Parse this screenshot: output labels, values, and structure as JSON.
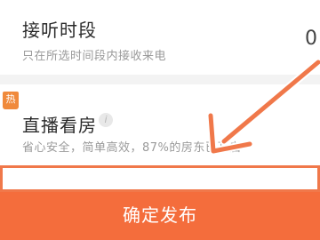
{
  "time_period": {
    "title": "接听时段",
    "subtitle": "只在所选时间段内接收来电",
    "value": "0"
  },
  "live_viewing": {
    "badge": "热",
    "title": "直播看房",
    "info_icon": "i",
    "subtitle": "省心安全，简单高效，87%的房东已开启"
  },
  "publish_button": {
    "label": "确定发布"
  },
  "colors": {
    "accent": "#f46d3c",
    "badge": "#f08a3c",
    "annotation": "#f0784a"
  }
}
